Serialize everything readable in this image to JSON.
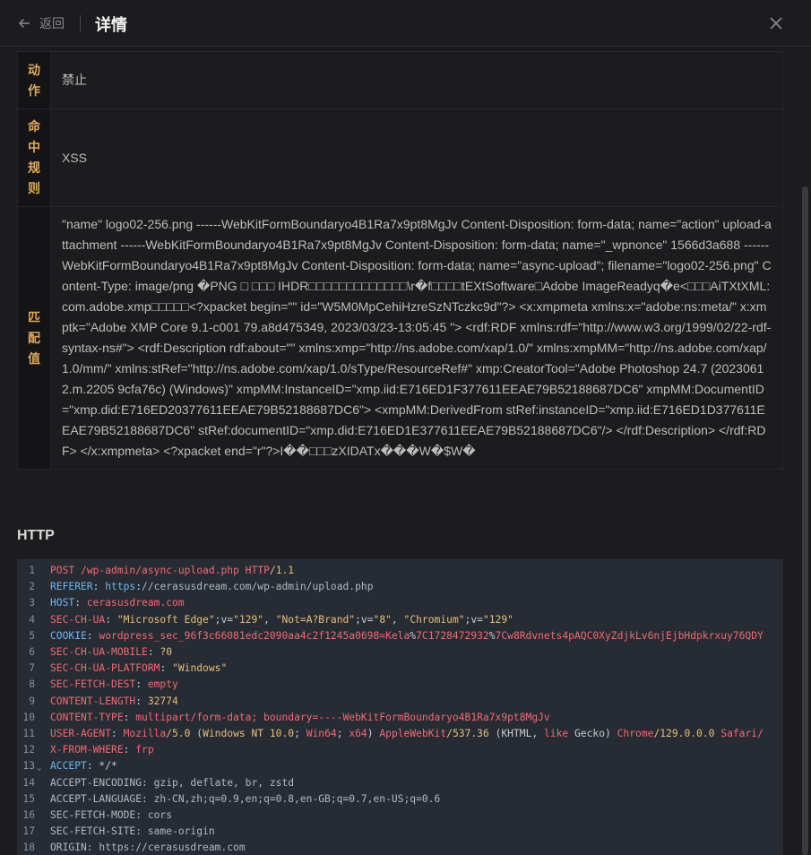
{
  "header": {
    "back_label": "返回",
    "title": "详情"
  },
  "details": [
    {
      "label": "动作",
      "value": "禁止"
    },
    {
      "label": "命中规则",
      "value": "XSS"
    },
    {
      "label": "匹配值",
      "value": "\"name\" logo02-256.png ------WebKitFormBoundaryo4B1Ra7x9pt8MgJv Content-Disposition: form-data; name=\"action\" upload-attachment ------WebKitFormBoundaryo4B1Ra7x9pt8MgJv Content-Disposition: form-data; name=\"_wpnonce\" 1566d3a688 ------WebKitFormBoundaryo4B1Ra7x9pt8MgJv Content-Disposition: form-data; name=\"async-upload\"; filename=\"logo02-256.png\" Content-Type: image/png �PNG □ □□□ IHDR□□□□□□□□□□□□□\\r�f□□□□tEXtSoftware□Adobe ImageReadyq�e<□□□AiTXtXML:com.adobe.xmp□□□□□<?xpacket begin=\"\" id=\"W5M0MpCehiHzreSzNTczkc9d\"?> <x:xmpmeta xmlns:x=\"adobe:ns:meta/\" x:xmptk=\"Adobe XMP Core 9.1-c001 79.a8d475349, 2023/03/23-13:05:45 \"> <rdf:RDF xmlns:rdf=\"http://www.w3.org/1999/02/22-rdf-syntax-ns#\"> <rdf:Description rdf:about=\"\" xmlns:xmp=\"http://ns.adobe.com/xap/1.0/\" xmlns:xmpMM=\"http://ns.adobe.com/xap/1.0/mm/\" xmlns:stRef=\"http://ns.adobe.com/xap/1.0/sType/ResourceRef#\" xmp:CreatorTool=\"Adobe Photoshop 24.7 (20230612.m.2205 9cfa76c) (Windows)\" xmpMM:InstanceID=\"xmp.iid:E716ED1F377611EEAE79B52188687DC6\" xmpMM:DocumentID=\"xmp.did:E716ED20377611EEAE79B52188687DC6\"> <xmpMM:DerivedFrom stRef:instanceID=\"xmp.iid:E716ED1D377611EEAE79B52188687DC6\" stRef:documentID=\"xmp.did:E716ED1E377611EEAE79B52188687DC6\"/> </rdf:Description> </rdf:RDF> </x:xmpmeta> <?xpacket end=\"r\"?>I��□□□zXIDATx���W�$W�"
    }
  ],
  "http": {
    "title": "HTTP",
    "lines": [
      {
        "num": "1",
        "parts": [
          [
            "POST",
            "red"
          ],
          [
            "  /wp-admin/",
            "red"
          ],
          [
            "async-upload.php ",
            "red"
          ],
          [
            "HTTP",
            "red"
          ],
          [
            "/1.1",
            "yellow"
          ]
        ]
      },
      {
        "num": "2",
        "parts": [
          [
            "REFERER",
            "blue"
          ],
          [
            ": ",
            "white"
          ],
          [
            "https",
            "blue"
          ],
          [
            ":",
            "white"
          ],
          [
            "//cerasusdream.com/wp-admin/upload.php",
            "gray"
          ]
        ]
      },
      {
        "num": "3",
        "parts": [
          [
            "HOST",
            "blue"
          ],
          [
            ": ",
            "white"
          ],
          [
            "cerasusdream.com",
            "red"
          ]
        ]
      },
      {
        "num": "4",
        "parts": [
          [
            "SEC-CH-UA",
            "red"
          ],
          [
            ": ",
            "white"
          ],
          [
            "\"Microsoft Edge\"",
            "yellow"
          ],
          [
            ";v=",
            "white"
          ],
          [
            "\"129\"",
            "yellow"
          ],
          [
            ", ",
            "white"
          ],
          [
            "\"Not=A?Brand\"",
            "yellow"
          ],
          [
            ";v=",
            "white"
          ],
          [
            "\"8\"",
            "yellow"
          ],
          [
            ", ",
            "white"
          ],
          [
            "\"Chromium\"",
            "yellow"
          ],
          [
            ";v=",
            "white"
          ],
          [
            "\"129\"",
            "yellow"
          ]
        ]
      },
      {
        "num": "5",
        "parts": [
          [
            "COOKIE",
            "blue"
          ],
          [
            ": ",
            "white"
          ],
          [
            "wordpress_sec_96f3c66081edc2090aa4c2f1245a0698=Kela",
            "red"
          ],
          [
            "%",
            "white"
          ],
          [
            "7C1728472932",
            "red"
          ],
          [
            "%",
            "white"
          ],
          [
            "7Cw8Rdvnets4pAQC0XyZdjkLv6njEjbHdpkrxuy76QDY",
            "red"
          ]
        ]
      },
      {
        "num": "6",
        "parts": [
          [
            "SEC-CH-UA-MOBILE",
            "red"
          ],
          [
            ": ",
            "white"
          ],
          [
            "?0",
            "yellow"
          ]
        ]
      },
      {
        "num": "7",
        "parts": [
          [
            "SEC-CH-UA-PLATFORM",
            "red"
          ],
          [
            ": ",
            "white"
          ],
          [
            "\"Windows\"",
            "yellow"
          ]
        ]
      },
      {
        "num": "8",
        "parts": [
          [
            "SEC-FETCH-DEST",
            "red"
          ],
          [
            ": ",
            "white"
          ],
          [
            "empty",
            "red"
          ]
        ]
      },
      {
        "num": "9",
        "parts": [
          [
            "CONTENT-LENGTH",
            "red"
          ],
          [
            ": ",
            "white"
          ],
          [
            "32774",
            "yellow"
          ]
        ]
      },
      {
        "num": "10",
        "parts": [
          [
            "CONTENT-TYPE",
            "red"
          ],
          [
            ": ",
            "white"
          ],
          [
            "multipart/form-data; boundary=",
            "red"
          ],
          [
            "----WebKitFormBoundaryo4B1Ra7x9pt8MgJv",
            "red"
          ]
        ]
      },
      {
        "num": "11",
        "parts": [
          [
            "USER-AGENT",
            "red"
          ],
          [
            ": ",
            "white"
          ],
          [
            "Mozilla",
            "red"
          ],
          [
            "/5.0",
            "yellow"
          ],
          [
            " (",
            "white"
          ],
          [
            "Windows NT 10.0",
            "yellow"
          ],
          [
            "; ",
            "white"
          ],
          [
            "Win64",
            "red"
          ],
          [
            "; ",
            "white"
          ],
          [
            "x64",
            "red"
          ],
          [
            ") ",
            "white"
          ],
          [
            "AppleWebKit",
            "red"
          ],
          [
            "/537.36",
            "yellow"
          ],
          [
            " (KHTML, ",
            "white"
          ],
          [
            "like",
            "red"
          ],
          [
            " Gecko) ",
            "white"
          ],
          [
            "Chrome",
            "red"
          ],
          [
            "/129.0.0.0",
            "yellow"
          ],
          [
            " ",
            "white"
          ],
          [
            "Safari/",
            "red"
          ]
        ]
      },
      {
        "num": "12",
        "parts": [
          [
            "X-FROM-WHERE",
            "red"
          ],
          [
            ": ",
            "white"
          ],
          [
            "frp",
            "red"
          ]
        ]
      },
      {
        "num": "13",
        "fold": true,
        "parts": [
          [
            "ACCEPT",
            "blue"
          ],
          [
            ": ",
            "white"
          ],
          [
            "*/*",
            "white"
          ]
        ]
      },
      {
        "num": "14",
        "parts": [
          [
            "ACCEPT-ENCODING: gzip, deflate, br, zstd",
            "gray"
          ]
        ]
      },
      {
        "num": "15",
        "parts": [
          [
            "ACCEPT-LANGUAGE: zh-CN,zh;q=0.9,en;q=0.8,en-GB;q=0.7,en-US;q=0.6",
            "gray"
          ]
        ]
      },
      {
        "num": "16",
        "parts": [
          [
            "SEC-FETCH-MODE: cors",
            "gray"
          ]
        ]
      },
      {
        "num": "17",
        "parts": [
          [
            "SEC-FETCH-SITE: same-origin",
            "gray"
          ]
        ]
      },
      {
        "num": "18",
        "parts": [
          [
            "ORIGIN: https://cerasusdream.com",
            "gray"
          ]
        ]
      }
    ]
  }
}
